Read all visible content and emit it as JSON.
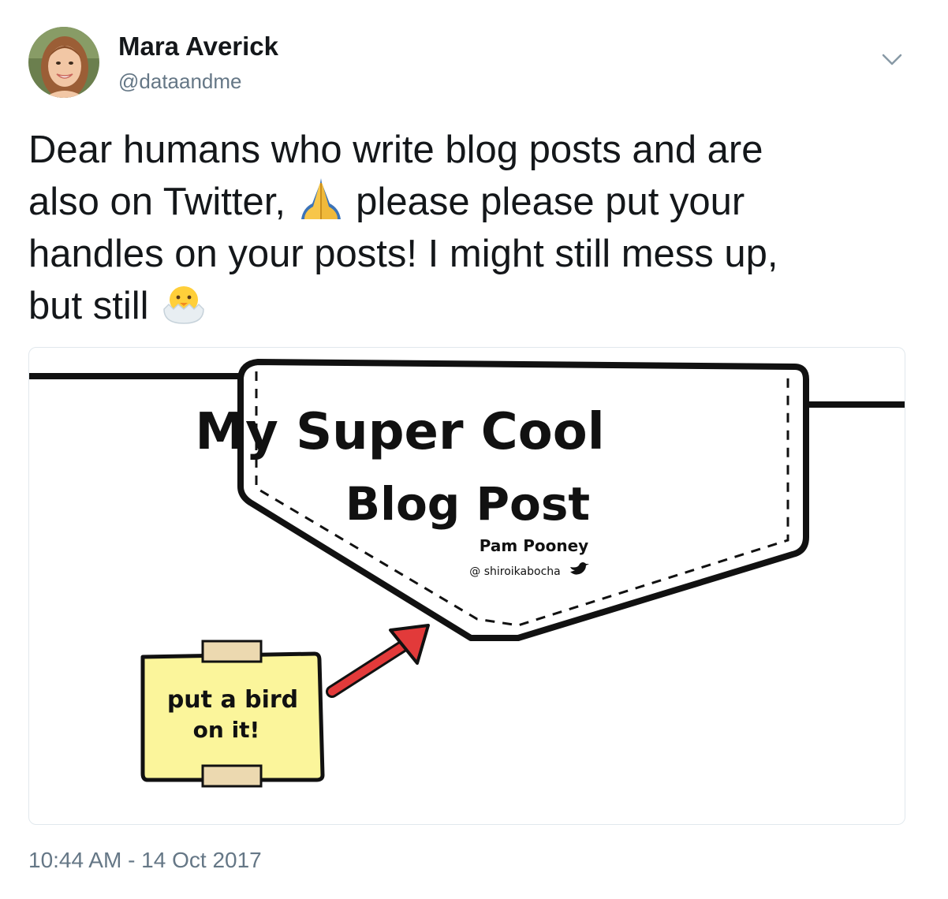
{
  "tweet": {
    "author_name": "Mara Averick",
    "author_handle": "@dataandme",
    "text_part1": "Dear humans who write blog posts and are\nalso on Twitter, ",
    "text_part2": " please please put your\nhandles on your posts! I might still mess up,\nbut still ",
    "emoji_1": "folded-hands-emoji",
    "emoji_2": "hatching-chick-emoji",
    "timestamp": "10:44 AM - 14 Oct 2017"
  },
  "image": {
    "title_line1": "My Super Cool",
    "title_line2": "Blog Post",
    "author": "Pam Pooney",
    "handle": "@ shiroikabocha",
    "note_line1": "put a bird",
    "note_line2": "on it!",
    "note_color": "#fbf59b",
    "tape_color": "#ecd9b0",
    "arrow_color": "#e23a3a"
  },
  "icons": {
    "menu": "chevron-down-icon",
    "bird": "twitter-bird-icon"
  },
  "colors": {
    "text": "#14171a",
    "secondary": "#657786",
    "border": "#e1e8ed"
  }
}
